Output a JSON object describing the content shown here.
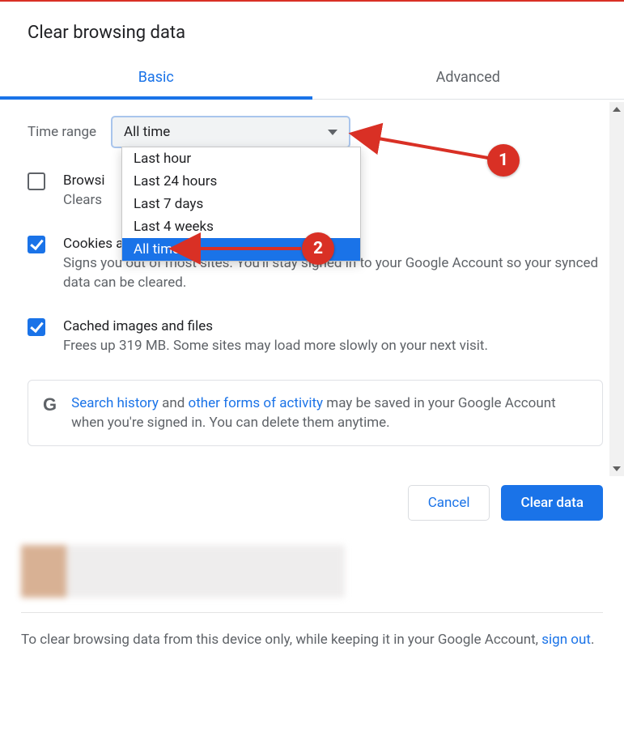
{
  "dialog": {
    "title": "Clear browsing data",
    "tabs": {
      "basic": "Basic",
      "advanced": "Advanced"
    }
  },
  "timerange": {
    "label": "Time range",
    "selected": "All time",
    "options": [
      "Last hour",
      "Last 24 hours",
      "Last 7 days",
      "Last 4 weeks",
      "All time"
    ]
  },
  "items": {
    "history": {
      "title_visible": "Browsi",
      "desc_visible": "Clears"
    },
    "cookies": {
      "title": "Cookies and other site data",
      "desc": "Signs you out of most sites. You'll stay signed in to your Google Account so your synced data can be cleared."
    },
    "cache": {
      "title": "Cached images and files",
      "desc": "Frees up 319 MB. Some sites may load more slowly on your next visit."
    }
  },
  "infobox": {
    "link1": "Search history",
    "mid1": " and ",
    "link2": "other forms of activity",
    "rest": " may be saved in your Google Account when you're signed in. You can delete them anytime."
  },
  "buttons": {
    "cancel": "Cancel",
    "clear": "Clear data"
  },
  "footer": {
    "text1": "To clear browsing data from this device only, while keeping it in your Google Account, ",
    "link": "sign out",
    "text2": "."
  },
  "annotations": {
    "one": "1",
    "two": "2"
  }
}
